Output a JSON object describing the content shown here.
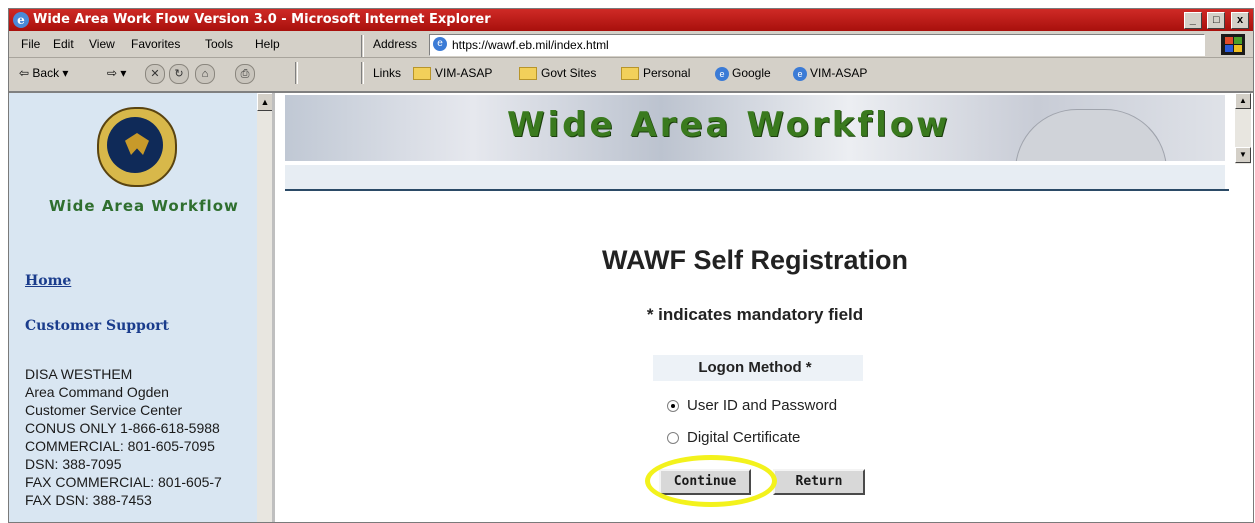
{
  "window": {
    "title": "Wide Area Work Flow Version 3.0 - Microsoft Internet Explorer",
    "controls": [
      "_",
      "□",
      "x"
    ]
  },
  "menu": {
    "items": [
      "File",
      "Edit",
      "View",
      "Favorites",
      "Tools",
      "Help"
    ],
    "address_label": "Address",
    "address_value": "https://wawf.eb.mil/index.html"
  },
  "toolbar": {
    "back_label": "Back",
    "links_label": "Links",
    "links": [
      "VIM-ASAP",
      "Govt Sites",
      "Personal",
      "Google",
      "VIM-ASAP"
    ]
  },
  "sidebar": {
    "brand": "Wide Area Workflow",
    "nav": [
      "Home",
      "Customer Support"
    ],
    "contact": [
      "DISA WESTHEM",
      "Area Command Ogden",
      "Customer Service Center",
      "CONUS ONLY 1-866-618-5988",
      "COMMERCIAL: 801-605-7095",
      "DSN: 388-7095",
      "FAX COMMERCIAL: 801-605-7",
      "FAX DSN: 388-7453"
    ]
  },
  "banner": {
    "title": "Wide Area Workflow"
  },
  "form": {
    "heading": "WAWF Self Registration",
    "mandatory_note": "* indicates mandatory field",
    "logon_label": "Logon Method *",
    "options": [
      {
        "label": "User ID and Password",
        "selected": true
      },
      {
        "label": "Digital Certificate",
        "selected": false
      }
    ],
    "continue_label": "Continue",
    "return_label": "Return"
  },
  "colors": {
    "title_bar": "#c21a16",
    "sidebar_bg": "#d9e6f2",
    "banner_text": "#3a7a1e",
    "highlight": "#f3f21c"
  }
}
